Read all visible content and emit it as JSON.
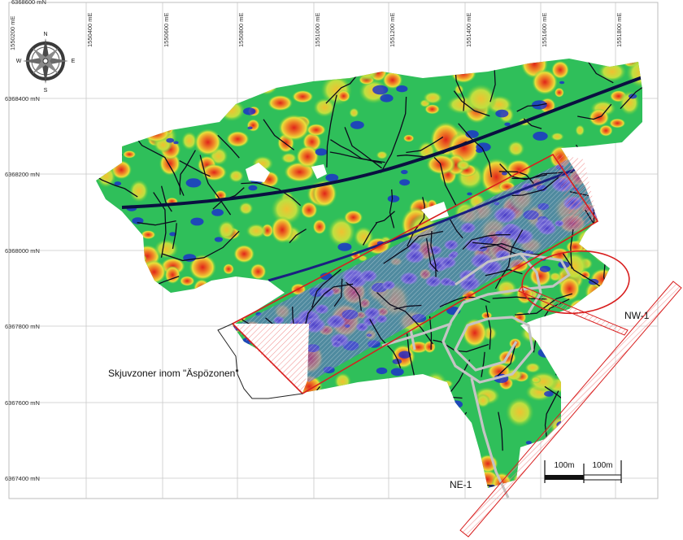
{
  "grid": {
    "easting_labels": [
      "1550200 mE",
      "1550400 mE",
      "1550600 mE",
      "1550800 mE",
      "1551000 mE",
      "1551200 mE",
      "1551400 mE",
      "1551600 mE",
      "1551800 mE"
    ],
    "northing_labels": [
      "6368600 mN",
      "6368400 mN",
      "6368200 mN",
      "6368000 mN",
      "6367800 mN",
      "6367600 mN",
      "6367400 mN"
    ]
  },
  "compass": {
    "n": "N",
    "s": "S",
    "e": "E",
    "w": "W"
  },
  "annotations": {
    "zone_label": "Skjuvzoner inom \"Äspözonen\"",
    "nw_label": "NW-1",
    "ne_label": "NE-1"
  },
  "scalebar": {
    "left": "100m",
    "right": "100m"
  },
  "colors": {
    "red_hot": "#e8261c",
    "orange": "#f0962a",
    "yellow": "#e6e233",
    "green": "#3cc83c",
    "cyan": "#38b8c8",
    "blue": "#2a36c8",
    "navy": "#0a1040",
    "zone": "#d81e1e",
    "tunnel": "#bdbdbd"
  }
}
